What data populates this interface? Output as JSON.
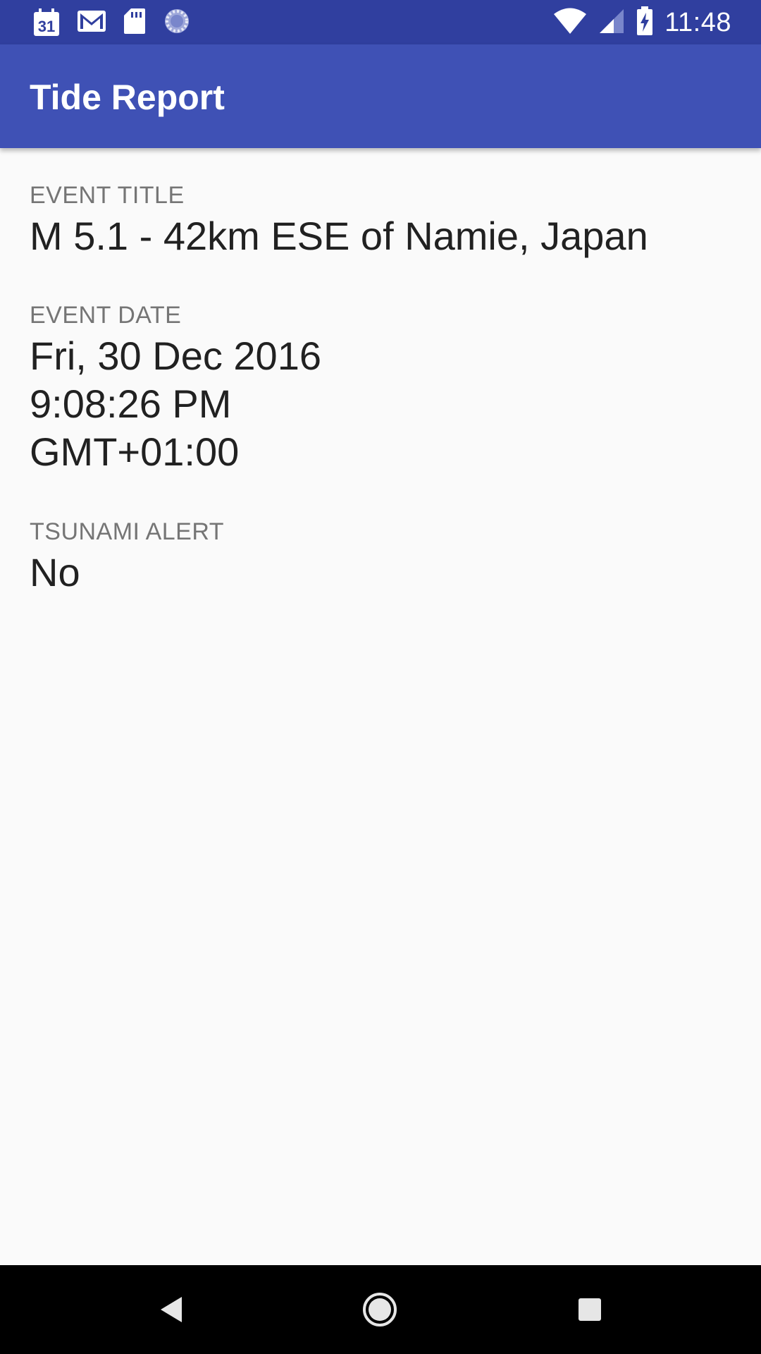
{
  "status_bar": {
    "time": "11:48",
    "calendar_day": "31",
    "left_icons": [
      "calendar-icon",
      "gmail-icon",
      "sd-card-icon",
      "sync-icon"
    ],
    "right_icons": [
      "wifi-icon",
      "signal-icon",
      "battery-charging-icon"
    ]
  },
  "app_bar": {
    "title": "Tide Report",
    "color": "#3f51b5",
    "status_color": "#303f9f"
  },
  "fields": {
    "event_title": {
      "label": "EVENT TITLE",
      "value": "M 5.1 - 42km ESE of Namie, Japan"
    },
    "event_date": {
      "label": "EVENT DATE",
      "lines": [
        "Fri, 30 Dec 2016",
        "9:08:26 PM",
        "GMT+01:00"
      ]
    },
    "tsunami_alert": {
      "label": "TSUNAMI ALERT",
      "value": "No"
    }
  },
  "nav_bar": {
    "buttons": [
      "back-icon",
      "home-icon",
      "recents-icon"
    ]
  }
}
